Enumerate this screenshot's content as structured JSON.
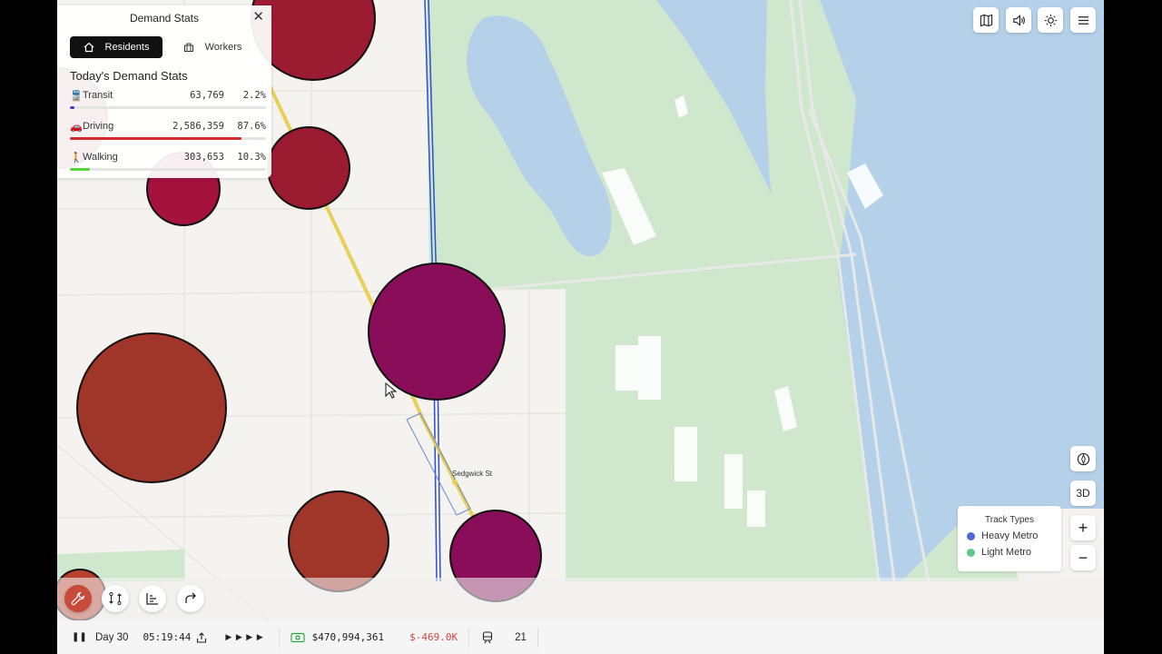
{
  "demand_panel": {
    "title": "Demand Stats",
    "close_glyph": "✕",
    "tabs": [
      {
        "label": "Residents",
        "icon": "home-icon",
        "active": true
      },
      {
        "label": "Workers",
        "icon": "building-icon",
        "active": false
      }
    ],
    "stats_title": "Today's Demand Stats",
    "stats": [
      {
        "label": "Transit",
        "count": "63,769",
        "percent": "2.2%",
        "share": 0.022,
        "color": "#3b3fd1",
        "icon": "train-icon"
      },
      {
        "label": "Driving",
        "count": "2,586,359",
        "percent": "87.6%",
        "share": 0.876,
        "color": "#d42a2a",
        "icon": "car-icon"
      },
      {
        "label": "Walking",
        "count": "303,653",
        "percent": "10.3%",
        "share": 0.103,
        "color": "#55d83a",
        "icon": "walking-icon"
      }
    ]
  },
  "top_toolbar": [
    {
      "name": "map-icon"
    },
    {
      "name": "volume-icon"
    },
    {
      "name": "sun-icon"
    },
    {
      "name": "menu-icon"
    }
  ],
  "map_controls": {
    "compass_label": "N",
    "view_3d": "3D",
    "zoom_in": "+",
    "zoom_out": "−"
  },
  "legend": {
    "title": "Track Types",
    "items": [
      {
        "label": "Heavy Metro",
        "color": "#4a68d8"
      },
      {
        "label": "Light Metro",
        "color": "#5cc98a"
      }
    ]
  },
  "map": {
    "station_label": "Sedgwick St"
  },
  "bottom_bar": {
    "pause_glyph": "❚❚",
    "day": "Day 30",
    "time": "05:19:44",
    "speed_glyph": "▶ ▶ ▶ ▶",
    "money": "$470,994,361",
    "rate": "$-469.0K",
    "rate_color": "#d04545",
    "train_count": "21"
  },
  "colors": {
    "park": "#cfe8cd",
    "water": "#b5d1ea",
    "demand_purple": "#8a0d5a",
    "demand_crimson": "#9b1b30",
    "demand_rust": "#a0352a"
  }
}
